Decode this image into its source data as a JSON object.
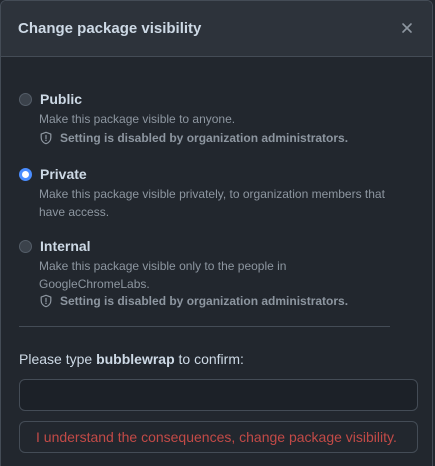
{
  "dialog": {
    "title": "Change package visibility",
    "close_icon": "x-icon"
  },
  "options": [
    {
      "label": "Public",
      "description": "Make this package visible to anyone.",
      "note": "Setting is disabled by organization administrators.",
      "checked": false
    },
    {
      "label": "Private",
      "description": "Make this package visible privately, to organization members that have access.",
      "checked": true
    },
    {
      "label": "Internal",
      "description": "Make this package visible only to the people in GoogleChromeLabs.",
      "note": "Setting is disabled by organization administrators.",
      "checked": false
    }
  ],
  "confirm": {
    "prefix": "Please type ",
    "package_name": "bubblewrap",
    "suffix": " to confirm:",
    "input_value": "",
    "button_label": "I understand the consequences, change package visibility."
  },
  "colors": {
    "accent": "#4a8dff",
    "danger": "#c24a47",
    "background": "#22272e",
    "header": "#2d333b"
  }
}
